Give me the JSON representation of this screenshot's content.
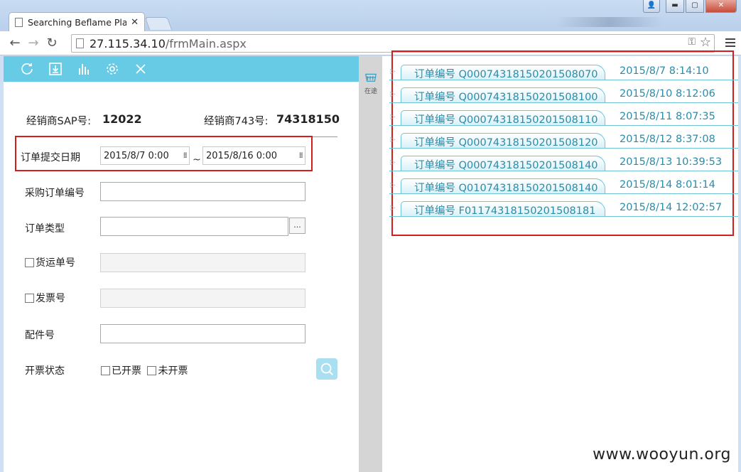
{
  "browser": {
    "tab_title": "Searching Beflame Platf",
    "url_host": "27.115.34.10",
    "url_path": "/frmMain.aspx"
  },
  "toolbar": {
    "icons": [
      "refresh-icon",
      "download-icon",
      "chart-icon",
      "settings-icon",
      "close-icon"
    ]
  },
  "info": {
    "sap_label": "经销商SAP号:",
    "sap_value": "12022",
    "dealer_label": "经销商743号:",
    "dealer_value": "74318150"
  },
  "form": {
    "submit_date_label": "订单提交日期",
    "date_from": "2015/8/7 0:00",
    "date_sep": "~",
    "date_to": "2015/8/16 0:00",
    "po_label": "采购订单编号",
    "po_value": "",
    "order_type_label": "订单类型",
    "order_type_value": "",
    "ellipsis": "...",
    "shipping_label": "货运单号",
    "shipping_value": "",
    "invoice_label": "发票号",
    "invoice_value": "",
    "part_label": "配件号",
    "part_value": "",
    "invoice_status_label": "开票状态",
    "invoiced_label": "已开票",
    "not_invoiced_label": "未开票"
  },
  "side": {
    "label": "在途"
  },
  "orders": [
    {
      "label": "订单编号 Q00074318150201508070",
      "date": "2015/8/7 8:14:10"
    },
    {
      "label": "订单编号 Q00074318150201508100",
      "date": "2015/8/10 8:12:06"
    },
    {
      "label": "订单编号 Q00074318150201508110",
      "date": "2015/8/11 8:07:35"
    },
    {
      "label": "订单编号 Q00074318150201508120",
      "date": "2015/8/12 8:37:08"
    },
    {
      "label": "订单编号 Q00074318150201508140",
      "date": "2015/8/13 10:39:53"
    },
    {
      "label": "订单编号 Q01074318150201508140",
      "date": "2015/8/14 8:01:14"
    },
    {
      "label": "订单编号 F01174318150201508181",
      "date": "2015/8/14 12:02:57"
    }
  ],
  "watermark": "www.wooyun.org",
  "colors": {
    "toolbar_bg": "#67cbe5",
    "order_text": "#2c8ba8",
    "highlight_box": "#d21e1e"
  }
}
